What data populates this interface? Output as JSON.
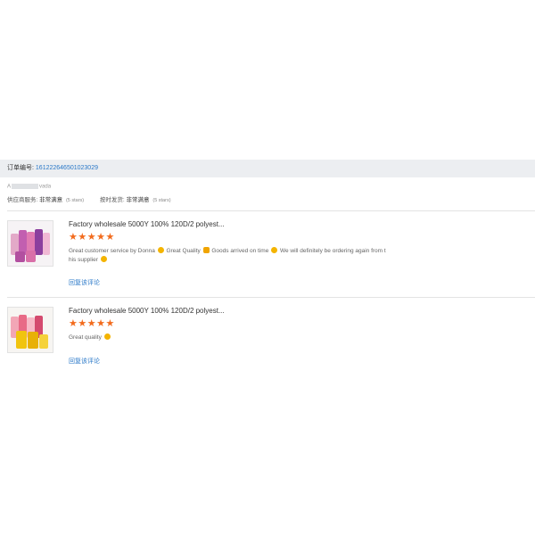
{
  "order": {
    "label": "订单编号:",
    "number": "161222646501023029"
  },
  "buyer": {
    "name_start": "A",
    "name_end": "vada"
  },
  "ratings": {
    "supplier_service_label": "供应商服务:",
    "supplier_service_value": "非常满意",
    "supplier_service_count": "(5 stars)",
    "delivery_label": "按时发货:",
    "delivery_value": "非常满意",
    "delivery_count": "(5 stars)"
  },
  "reviews": [
    {
      "product_title": "Factory wholesale 5000Y 100% 120D/2 polyest...",
      "stars": 5,
      "comment_parts": [
        "Great customer service by Donna",
        "Great Quality",
        "Goods arrived on time",
        "We will definitely be ordering again from this supplier"
      ],
      "reply_label": "回复该评论",
      "thumb_icon": "pink-purple-thread-spools"
    },
    {
      "product_title": "Factory wholesale 5000Y 100% 120D/2 polyest...",
      "stars": 5,
      "comment_parts": [
        "Great quality"
      ],
      "reply_label": "回复该评论",
      "thumb_icon": "yellow-pink-thread-spools"
    }
  ],
  "colors": {
    "link": "#2a78c8",
    "star": "#f26b1d",
    "header_bg": "#eceef1"
  }
}
